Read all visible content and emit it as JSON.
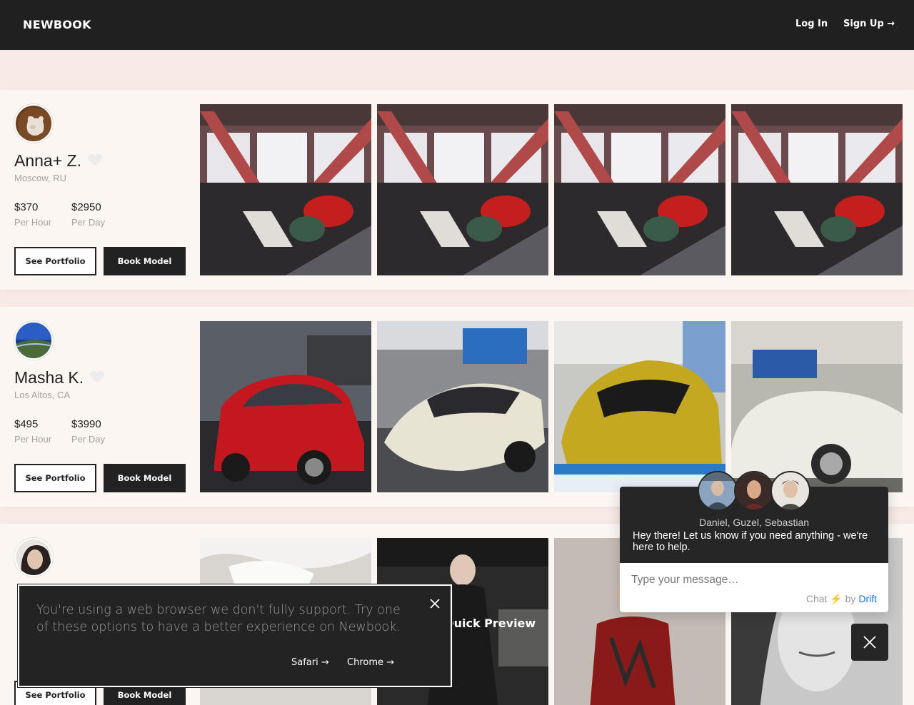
{
  "header": {
    "logo": "NEWBOOK",
    "login": "Log In",
    "signup": "Sign Up →"
  },
  "models": [
    {
      "name": "Anna+ Z.",
      "location": "Moscow, RU",
      "price_hour": "$370",
      "price_hour_label": "Per Hour",
      "price_day": "$2950",
      "price_day_label": "Per Day",
      "see_portfolio": "See Portfolio",
      "book_model": "Book Model"
    },
    {
      "name": "Masha K.",
      "location": "Los Altos, CA",
      "price_hour": "$495",
      "price_hour_label": "Per Hour",
      "price_day": "$3990",
      "price_day_label": "Per Day",
      "see_portfolio": "See Portfolio",
      "book_model": "Book Model"
    },
    {
      "see_portfolio": "See Portfolio",
      "book_model": "Book Model"
    }
  ],
  "quick_preview": "Quick Preview",
  "browser_warning": {
    "message": "You're using a web browser we don't fully support. Try one of these options to have a better experience on Newbook.",
    "safari": "Safari →",
    "chrome": "Chrome →"
  },
  "chat": {
    "agents": "Daniel, Guzel, Sebastian",
    "message": "Hey there! Let us know if you need anything - we're here to help.",
    "input_placeholder": "Type your message…",
    "credit_prefix": "Chat",
    "credit_by": "by",
    "credit_brand": "Drift"
  }
}
